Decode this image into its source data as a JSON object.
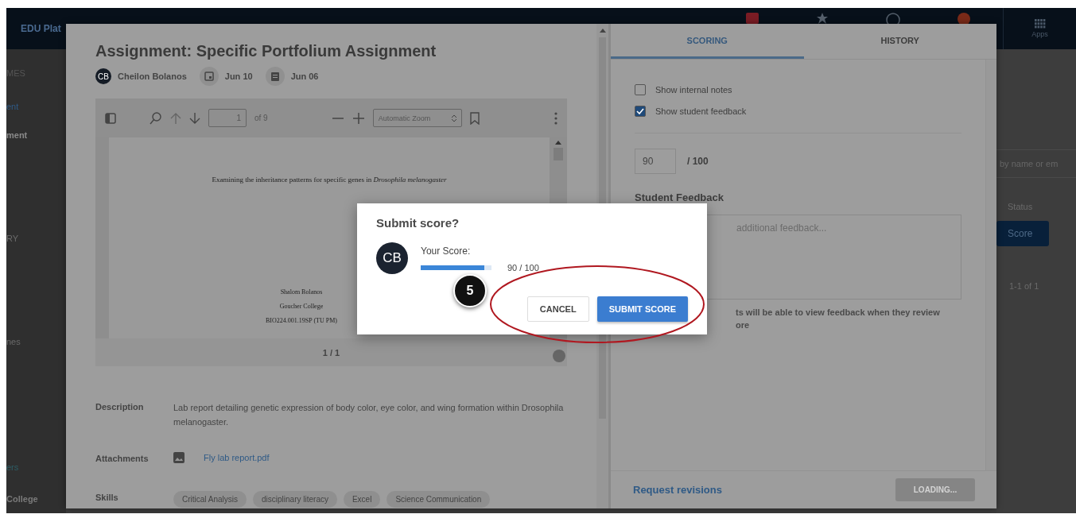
{
  "background": {
    "brand": "EDU Plat",
    "apps_label": "Apps",
    "sidebar_items": [
      "MES",
      "ent",
      "ment",
      "RY",
      "nes",
      "ers",
      "College"
    ],
    "search": {
      "placeholder": "by name or em"
    },
    "column_header": "Status",
    "score_button": "Score",
    "pagination": "1-1 of 1"
  },
  "assignment": {
    "title": "Assignment: Specific Portfolium Assignment",
    "student": {
      "initials": "CB",
      "name": "Cheilon Bolanos"
    },
    "due_date": "Jun 10",
    "submitted_date": "Jun 06",
    "viewer": {
      "page_input": "1",
      "page_count": "of 9",
      "zoom": "Automatic Zoom",
      "page_indicator": "1 / 1",
      "document": {
        "heading": "Examining the inheritance patterns for specific genes in *Drosophila melanogaster*",
        "lines": [
          "Shalom Bolanos",
          "Goucher College",
          "BIO224.001.19SP (TU PM)"
        ]
      }
    },
    "details": [
      {
        "kind": "text",
        "label": "Description",
        "value": "Lab report detailing genetic expression of body color, eye color, and wing formation within Drosophila melanogaster."
      },
      {
        "kind": "attachment",
        "label": "Attachments",
        "value": "Fly lab report.pdf"
      },
      {
        "kind": "tags",
        "label": "Skills",
        "tags": [
          "Critical Analysis",
          "disciplinary literacy",
          "Excel",
          "Science Communication"
        ]
      }
    ]
  },
  "scoring": {
    "tabs": [
      {
        "label": "SCORING",
        "selected": true
      },
      {
        "label": "HISTORY",
        "selected": false
      }
    ],
    "options": [
      {
        "label": "Show internal notes",
        "checked": false
      },
      {
        "label": "Show student feedback",
        "checked": true
      }
    ],
    "score_value": "90",
    "score_max": "/ 100",
    "feedback_label": "Student Feedback",
    "feedback_placeholder": "additional feedback...",
    "note_lines": [
      "ts will be able to view feedback when they review",
      "ore"
    ],
    "request_link": "Request revisions",
    "submit": {
      "label": "LOADING...",
      "disabled": true
    }
  },
  "dialog": {
    "title": "Submit score?",
    "initials": "CB",
    "score_label": "Your Score:",
    "level": 0.9,
    "score_text": "90 / 100",
    "buttons": [
      {
        "kind": "secondary",
        "label": "CANCEL"
      },
      {
        "kind": "primary",
        "label": "SUBMIT SCORE"
      }
    ]
  },
  "annotation": {
    "step": "5"
  }
}
